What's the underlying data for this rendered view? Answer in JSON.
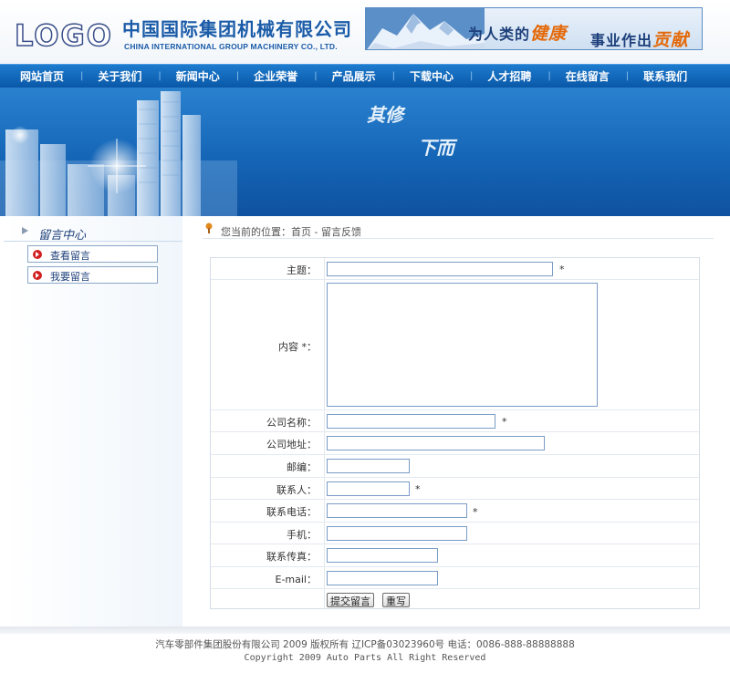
{
  "header": {
    "logo_text": "LOGO",
    "company_cn": "中国国际集团机械有限公司",
    "company_en": "CHINA INTERNATIONAL GROUP MACHINERY CO., LTD.",
    "banner_line1_a": "为人类的",
    "banner_line1_b": "健康",
    "banner_line2_a": "事业作出",
    "banner_line2_b": "贡献"
  },
  "nav": {
    "items": [
      "网站首页",
      "关于我们",
      "新闻中心",
      "企业荣誉",
      "产品展示",
      "下载中心",
      "人才招聘",
      "在线留言",
      "联系我们"
    ],
    "separator": "|"
  },
  "hero": {
    "line1": "其修",
    "line2": "下而"
  },
  "sidebar": {
    "title": "留言中心",
    "items": [
      {
        "label": "查看留言"
      },
      {
        "label": "我要留言"
      }
    ]
  },
  "breadcrumb": {
    "text": "您当前的位置：首页 - 留言反馈"
  },
  "form": {
    "subject_label": "主题：",
    "content_label": "内容 *：",
    "company_label": "公司名称：",
    "address_label": "公司地址：",
    "zip_label": "邮编：",
    "contact_label": "联系人：",
    "phone_label": "联系电话：",
    "mobile_label": "手机：",
    "fax_label": "联系传真：",
    "email_label": "E-mail：",
    "required_mark": "*",
    "submit_label": "提交留言",
    "reset_label": "重写"
  },
  "footer": {
    "line1": "汽车零部件集团股份有限公司 2009 版权所有 辽ICP备03023960号 电话：0086-888-88888888",
    "line2": "Copyright 2009 Auto Parts All Right Reserved"
  },
  "colors": {
    "brand_blue": "#1a5ba8",
    "nav_blue": "#0a58a8",
    "accent_orange": "#e46a0b",
    "bullet_red": "#d21f1f"
  }
}
